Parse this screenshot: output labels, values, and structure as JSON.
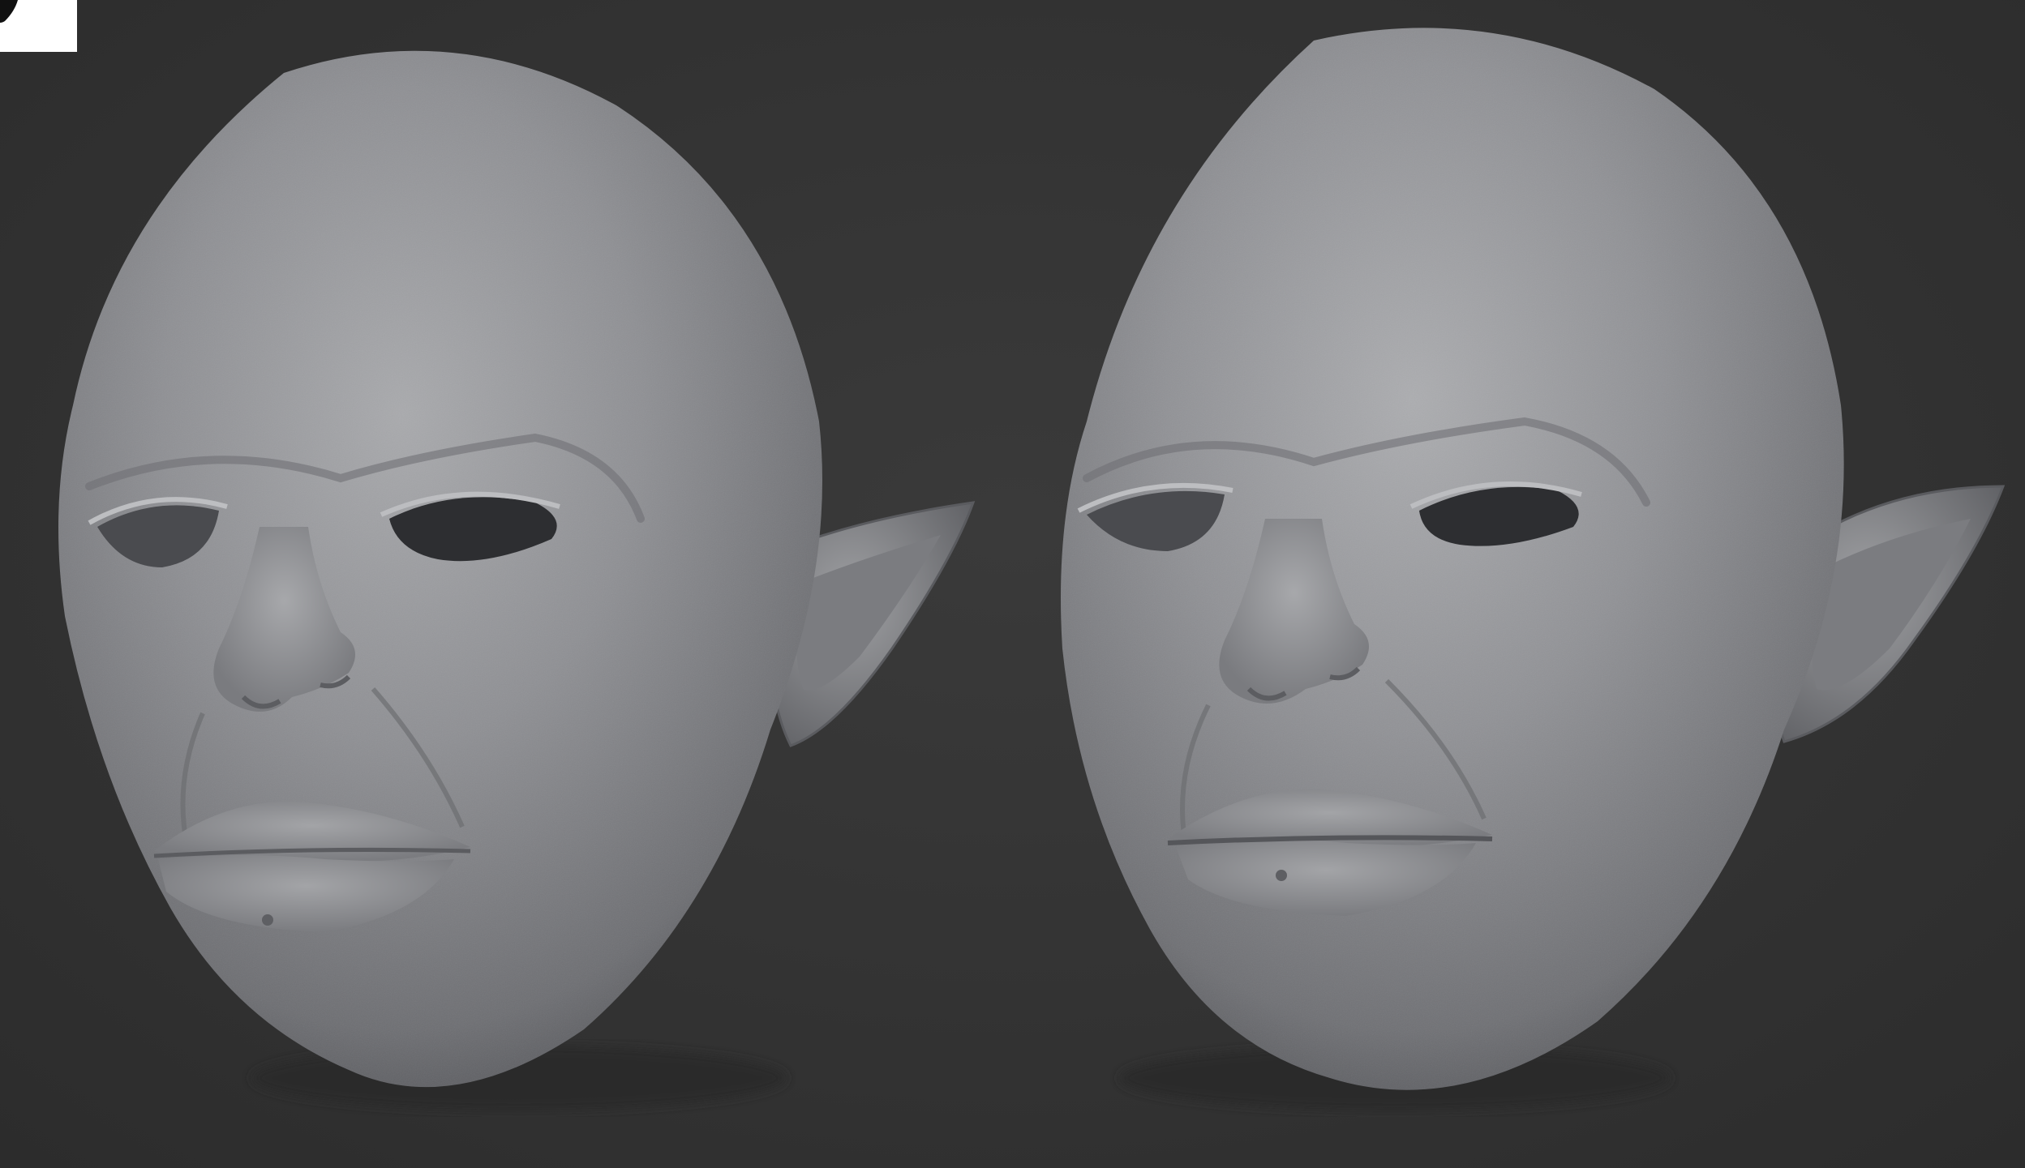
{
  "viewport": {
    "background_color": "#333333",
    "model_color": "#8e8f92"
  },
  "models": [
    {
      "id": "left",
      "description_icon": "sculpt-head-smooth-icon"
    },
    {
      "id": "right",
      "description_icon": "sculpt-head-detailed-icon"
    }
  ],
  "corner_badge": {
    "icon": "moon-logo-icon",
    "color": "#ffffff"
  }
}
